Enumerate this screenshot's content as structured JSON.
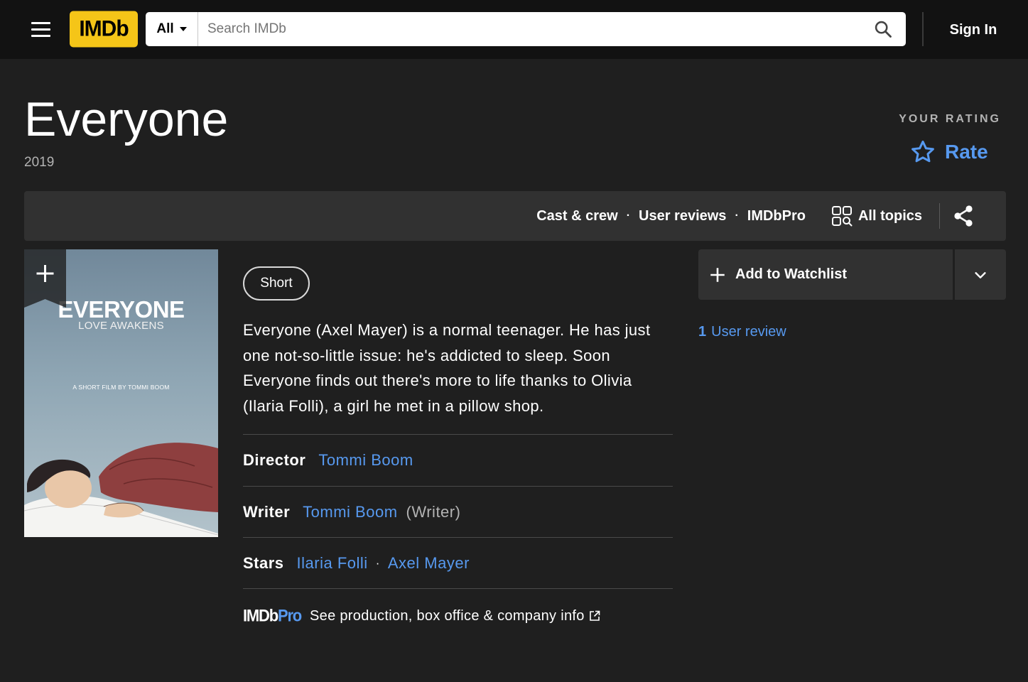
{
  "header": {
    "logo_text": "IMDb",
    "search_category": "All",
    "search_placeholder": "Search IMDb",
    "sign_in": "Sign In"
  },
  "title": {
    "name": "Everyone",
    "year": "2019",
    "your_rating_label": "YOUR RATING",
    "rate_label": "Rate"
  },
  "subnav": {
    "links": [
      "Cast & crew",
      "User reviews",
      "IMDbPro"
    ],
    "all_topics": "All topics"
  },
  "poster": {
    "title": "EVERYONE",
    "tagline": "LOVE AWAKENS",
    "credit": "A SHORT FILM BY TOMMI BOOM"
  },
  "details": {
    "genre_chip": "Short",
    "plot": "Everyone (Axel Mayer) is a normal teenager. He has just one not-so-little issue: he's addicted to sleep. Soon Everyone finds out there's more to life thanks to Olivia (Ilaria Folli), a girl he met in a pillow shop.",
    "director_label": "Director",
    "director": "Tommi Boom",
    "writer_label": "Writer",
    "writer": "Tommi Boom",
    "writer_role": "(Writer)",
    "stars_label": "Stars",
    "stars": [
      "Ilaria Folli",
      "Axel Mayer"
    ],
    "pro_logo_a": "IMDb",
    "pro_logo_b": "Pro",
    "pro_text": "See production, box office & company info"
  },
  "sidebar": {
    "watchlist_label": "Add to Watchlist",
    "user_review_count": "1",
    "user_review_label": "User review"
  },
  "colors": {
    "accent": "#f5c518",
    "link": "#5799ef",
    "background": "#1f1f1f",
    "topbar": "#121212",
    "panel": "#313131"
  }
}
